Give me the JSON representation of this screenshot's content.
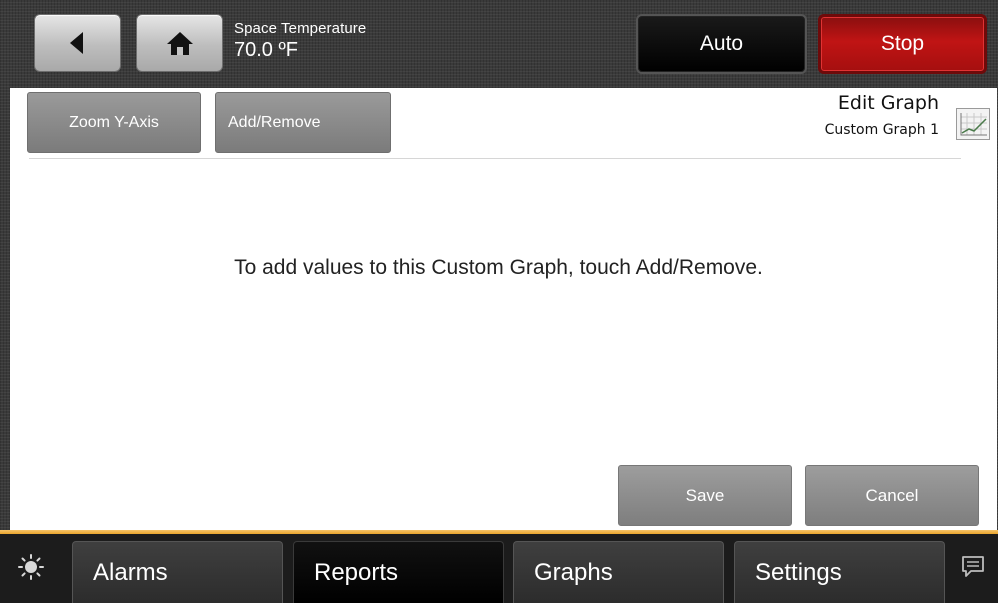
{
  "header": {
    "point_label": "Space Temperature",
    "point_value": "70.0 ºF",
    "mode_label": "Auto",
    "stop_label": "Stop"
  },
  "toolbar": {
    "zoom_label": "Zoom Y-Axis",
    "add_remove_label": "Add/Remove"
  },
  "graph": {
    "title": "Edit Graph",
    "name": "Custom Graph 1"
  },
  "main": {
    "message": "To add values to this Custom Graph, touch Add/Remove."
  },
  "actions": {
    "save_label": "Save",
    "cancel_label": "Cancel"
  },
  "bottom_nav": {
    "items": [
      {
        "label": "Alarms"
      },
      {
        "label": "Reports"
      },
      {
        "label": "Graphs"
      },
      {
        "label": "Settings"
      }
    ],
    "selected": "Reports"
  },
  "colors": {
    "stop_red": "#c01414",
    "accent_orange": "#e9a52c",
    "button_gray": "#8a8a8a"
  },
  "icons": [
    "back-arrow-icon",
    "home-icon",
    "graph-icon",
    "brightness-icon",
    "chat-bubble-icon"
  ]
}
